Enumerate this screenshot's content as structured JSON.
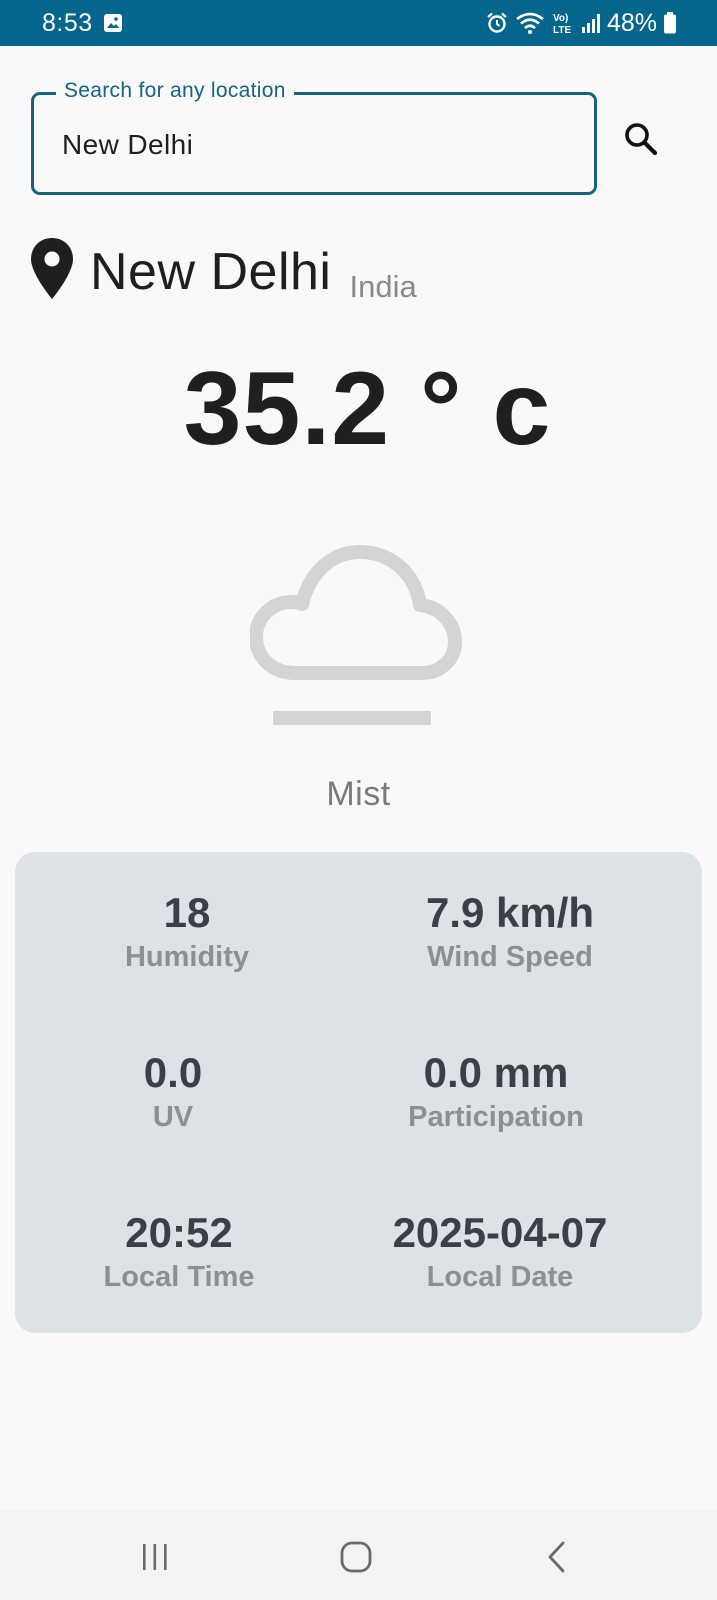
{
  "status_bar": {
    "time": "8:53",
    "battery": "48%",
    "icons": [
      "gallery-icon",
      "alarm-icon",
      "wifi-icon",
      "volte-icon",
      "signal-icon",
      "battery-icon"
    ]
  },
  "search": {
    "label": "Search for any location",
    "value": "New Delhi"
  },
  "location": {
    "city": "New Delhi",
    "country": "India"
  },
  "weather": {
    "temperature": "35.2 ° c",
    "condition": "Mist",
    "icon": "mist-cloud-icon"
  },
  "details": [
    {
      "value": "18",
      "label": "Humidity"
    },
    {
      "value": "7.9 km/h",
      "label": "Wind Speed"
    },
    {
      "value": "0.0",
      "label": "UV"
    },
    {
      "value": "0.0 mm",
      "label": "Participation"
    },
    {
      "value": "20:52",
      "label": "Local Time"
    },
    {
      "value": "2025-04-07",
      "label": "Local Date"
    }
  ],
  "colors": {
    "status_bar": "#04668c",
    "accent": "#16637e",
    "card_bg": "#dde2e6",
    "background": "#f9f9fb"
  },
  "nav": [
    "recents-icon",
    "home-icon",
    "back-icon"
  ]
}
